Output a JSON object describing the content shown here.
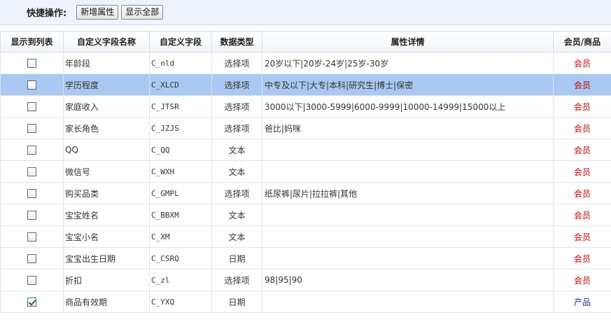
{
  "toolbar": {
    "label": "快捷操作:",
    "add_label": "新增属性",
    "show_all_label": "显示全部"
  },
  "table": {
    "headers": [
      "显示到列表",
      "自定义字段名称",
      "自定义字段",
      "数据类型",
      "属性详情",
      "会员/商品"
    ],
    "rows": [
      {
        "checked": false,
        "name": "年龄段",
        "field": "C_nld",
        "type": "选择项",
        "detail": "20岁以下|20岁-24岁|25岁-30岁",
        "scope": "会员",
        "scope_kind": "member",
        "selected": false
      },
      {
        "checked": false,
        "name": "学历程度",
        "field": "C_XLCD",
        "type": "选择项",
        "detail": "中专及以下|大专|本科|研究生|博士|保密",
        "scope": "会员",
        "scope_kind": "member",
        "selected": true
      },
      {
        "checked": false,
        "name": "家庭收入",
        "field": "C_JTSR",
        "type": "选择项",
        "detail": "3000以下|3000-5999|6000-9999|10000-14999|15000以上",
        "scope": "会员",
        "scope_kind": "member",
        "selected": false
      },
      {
        "checked": false,
        "name": "家长角色",
        "field": "C_JZJS",
        "type": "选择项",
        "detail": "爸比|妈咪",
        "scope": "会员",
        "scope_kind": "member",
        "selected": false
      },
      {
        "checked": false,
        "name": "QQ",
        "field": "C_QQ",
        "type": "文本",
        "detail": "",
        "scope": "会员",
        "scope_kind": "member",
        "selected": false
      },
      {
        "checked": false,
        "name": "微信号",
        "field": "C_WXH",
        "type": "文本",
        "detail": "",
        "scope": "会员",
        "scope_kind": "member",
        "selected": false
      },
      {
        "checked": false,
        "name": "购买品类",
        "field": "C_GMPL",
        "type": "选择项",
        "detail": "纸尿裤|尿片|拉拉裤|其他",
        "scope": "会员",
        "scope_kind": "member",
        "selected": false
      },
      {
        "checked": false,
        "name": "宝宝姓名",
        "field": "C_BBXM",
        "type": "文本",
        "detail": "",
        "scope": "会员",
        "scope_kind": "member",
        "selected": false
      },
      {
        "checked": false,
        "name": "宝宝小名",
        "field": "C_XM",
        "type": "文本",
        "detail": "",
        "scope": "会员",
        "scope_kind": "member",
        "selected": false
      },
      {
        "checked": false,
        "name": "宝宝出生日期",
        "field": "C_CSRQ",
        "type": "日期",
        "detail": "",
        "scope": "会员",
        "scope_kind": "member",
        "selected": false
      },
      {
        "checked": false,
        "name": "折扣",
        "field": "C_zl",
        "type": "选择项",
        "detail": "98|95|90",
        "scope": "会员",
        "scope_kind": "member",
        "selected": false
      },
      {
        "checked": true,
        "name": "商品有效期",
        "field": "C_YXQ",
        "type": "日期",
        "detail": "",
        "scope": "产品",
        "scope_kind": "product",
        "selected": false
      }
    ]
  },
  "colors": {
    "member": "#c00000",
    "product": "#1a2f8a",
    "selected_row": "#a9c9f2",
    "toolbar_bg": "#eef3fb"
  }
}
